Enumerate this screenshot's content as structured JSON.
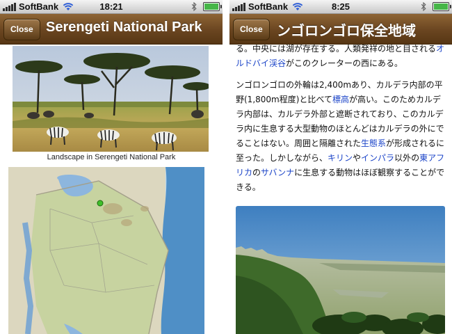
{
  "left_screen": {
    "status": {
      "carrier": "SoftBank",
      "time": "18:21"
    },
    "nav": {
      "close_label": "Close",
      "title": "Serengeti National Park"
    },
    "caption": "Landscape in Serengeti National Park"
  },
  "right_screen": {
    "status": {
      "carrier": "SoftBank",
      "time": "8:25"
    },
    "nav": {
      "close_label": "Close",
      "title": "ンゴロンゴロ保全地域"
    },
    "para1": {
      "t1": "る。中央には湖が存在する。人類発祥の地と目される",
      "link1": "オルドバイ渓谷",
      "t2": "がこのクレーターの西にある。"
    },
    "para2": {
      "t1": "ンゴロンゴロの外輪は2,400mあり、カルデラ内部の平野(1,800m程度)と比べて",
      "link1": "標高",
      "t2": "が高い。このためカルデラ内部は、カルデラ外部と遮断されており、このカルデラ内に生息する大型動物のほとんどはカルデラの外にでることはない。周囲と隔離された",
      "link2": "生態系",
      "t3": "が形成されるに至った。しかしながら、",
      "link3": "キリン",
      "t4": "や",
      "link4": "インパラ",
      "t5": "以外の",
      "link5": "東アフリカ",
      "t6": "の",
      "link6": "サバンナ",
      "t7": "に生息する動物はほぼ観察することができる。"
    }
  },
  "battery_level": 0.9,
  "colors": {
    "nav_brown": "#6a4520",
    "link_blue": "#1b44c8",
    "status_gray": "#c9c9c9"
  },
  "icons": [
    "signal-bars-icon",
    "wifi-icon",
    "bluetooth-icon",
    "battery-icon"
  ]
}
